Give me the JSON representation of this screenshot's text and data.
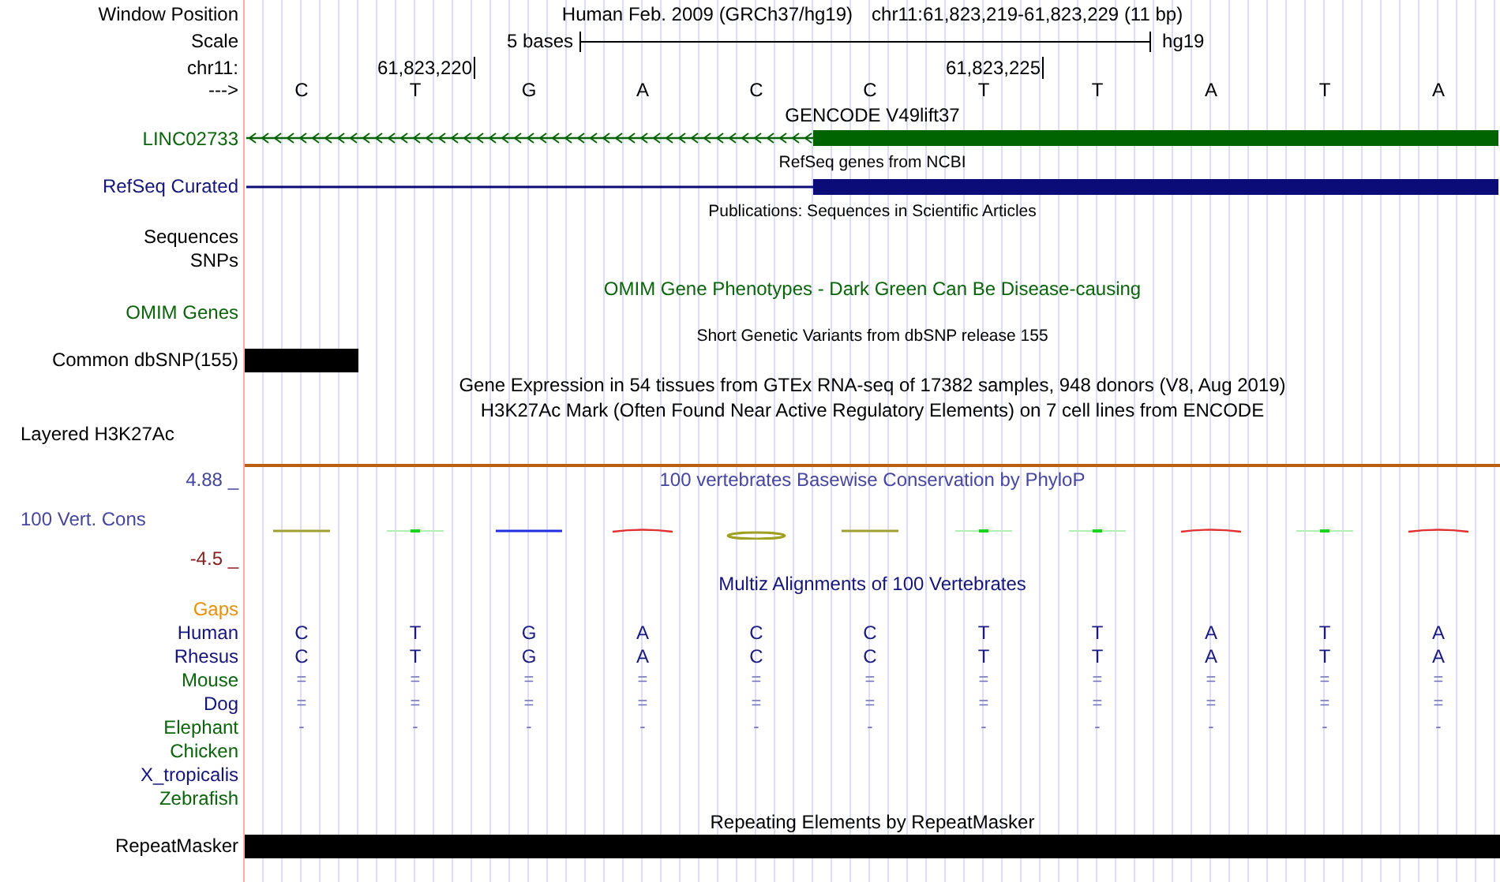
{
  "header": {
    "label": "Window Position",
    "title": "Human Feb. 2009 (GRCh37/hg19)",
    "position": "chr11:61,823,219-61,823,229 (11 bp)"
  },
  "scale": {
    "label": "Scale",
    "length": "5 bases",
    "assembly": "hg19"
  },
  "coordinates": {
    "label": "chr11:",
    "ticks": [
      "61,823,220",
      "61,823,225"
    ]
  },
  "sequence": {
    "label": "--->",
    "bases": [
      "C",
      "T",
      "G",
      "A",
      "C",
      "C",
      "T",
      "T",
      "A",
      "T",
      "A"
    ]
  },
  "gencode": {
    "title": "GENCODE V49lift37",
    "label": "LINC02733"
  },
  "refseq": {
    "title": "RefSeq genes from NCBI",
    "label": "RefSeq Curated"
  },
  "publications": {
    "title": "Publications: Sequences in Scientific Articles"
  },
  "sequences": {
    "label": "Sequences"
  },
  "snps": {
    "label": "SNPs"
  },
  "omim": {
    "title": "OMIM Gene Phenotypes - Dark Green Can Be Disease-causing",
    "label": "OMIM Genes"
  },
  "dbsnp": {
    "title": "Short Genetic Variants from dbSNP release 155",
    "label": "Common dbSNP(155)"
  },
  "gtex": {
    "title": "Gene Expression in 54 tissues from GTEx RNA-seq of 17382 samples, 948 donors (V8, Aug 2019)"
  },
  "h3k27ac": {
    "title": "H3K27Ac Mark (Often Found Near Active Regulatory Elements) on 7 cell lines from ENCODE",
    "label": "Layered H3K27Ac"
  },
  "phylop": {
    "title": "100 vertebrates Basewise Conservation by PhyloP",
    "label": "100 Vert. Cons",
    "max": "4.88 _",
    "min": "-4.5 _"
  },
  "multiz": {
    "title": "Multiz Alignments of 100 Vertebrates",
    "gaps_label": "Gaps",
    "species": [
      {
        "name": "Human",
        "color": "#14147a",
        "kind": "sequence",
        "bases": [
          "C",
          "T",
          "G",
          "A",
          "C",
          "C",
          "T",
          "T",
          "A",
          "T",
          "A"
        ]
      },
      {
        "name": "Rhesus",
        "color": "#14147a",
        "kind": "sequence",
        "bases": [
          "C",
          "T",
          "G",
          "A",
          "C",
          "C",
          "T",
          "T",
          "A",
          "T",
          "A"
        ]
      },
      {
        "name": "Mouse",
        "color": "#0a640a",
        "kind": "gap",
        "bases": [
          "=",
          "=",
          "=",
          "=",
          "=",
          "=",
          "=",
          "=",
          "=",
          "=",
          "="
        ]
      },
      {
        "name": "Dog",
        "color": "#14147a",
        "kind": "gap",
        "bases": [
          "=",
          "=",
          "=",
          "=",
          "=",
          "=",
          "=",
          "=",
          "=",
          "=",
          "="
        ]
      },
      {
        "name": "Elephant",
        "color": "#0a640a",
        "kind": "gap",
        "bases": [
          "-",
          "-",
          "-",
          "-",
          "-",
          "-",
          "-",
          "-",
          "-",
          "-",
          "-"
        ]
      },
      {
        "name": "Chicken",
        "color": "#0a640a",
        "kind": "none"
      },
      {
        "name": "X_tropicalis",
        "color": "#14147a",
        "kind": "none"
      },
      {
        "name": "Zebrafish",
        "color": "#0a640a",
        "kind": "none"
      }
    ]
  },
  "repeatmasker": {
    "title": "Repeating Elements by RepeatMasker",
    "label": "RepeatMasker"
  }
}
